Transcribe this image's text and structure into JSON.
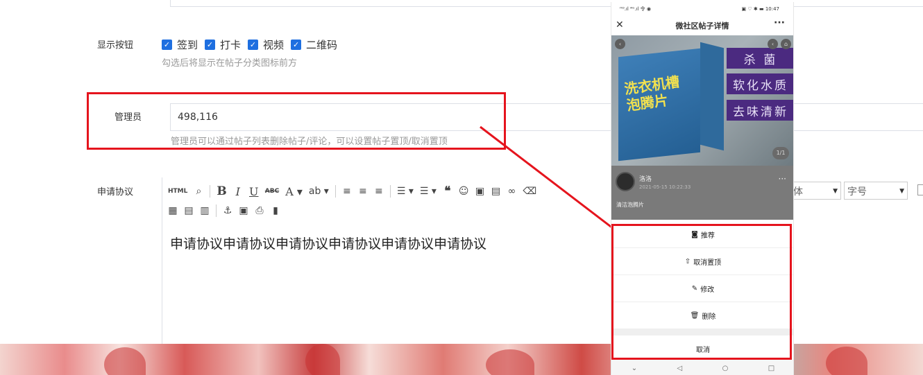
{
  "form": {
    "show_buttons": {
      "label": "显示按钮",
      "options": [
        {
          "label": "签到",
          "checked": true
        },
        {
          "label": "打卡",
          "checked": true
        },
        {
          "label": "视频",
          "checked": true
        },
        {
          "label": "二维码",
          "checked": true
        }
      ],
      "hint": "勾选后将显示在帖子分类图标前方"
    },
    "admin": {
      "label": "管理员",
      "value": "498,116",
      "hint": "管理员可以通过帖子列表删除帖子/评论，可以设置帖子置顶/取消置顶"
    },
    "agreement": {
      "label": "申请协议",
      "content": "申请协议申请协议申请协议申请协议申请协议申请协议",
      "font_family_placeholder": "体",
      "font_size_placeholder": "字号",
      "toolbar_icons": [
        "html-icon",
        "search-replace-icon",
        "bold-icon",
        "italic-icon",
        "underline-icon",
        "strikethrough-icon",
        "font-color-icon",
        "highlight-color-icon",
        "align-left-icon",
        "align-center-icon",
        "align-right-icon",
        "ordered-list-icon",
        "unordered-list-icon",
        "quote-icon",
        "emoji-icon",
        "image-icon",
        "attachment-icon",
        "link-icon",
        "eraser-icon",
        "table-icon",
        "table-row-icon",
        "table-column-icon",
        "anchor-icon",
        "template-icon",
        "print-icon",
        "paste-icon"
      ]
    }
  },
  "phone": {
    "status_left": "ᴴᴰ.ıl ⁴ᴳ.ıl 令 ◉",
    "status_right": "▣ ♡ ✱ ▬ 10:47",
    "nav_title": "微社区帖子详情",
    "product_box_text": "洗衣机槽\n泡腾片",
    "features": [
      "杀 菌",
      "软化水质",
      "去味清新"
    ],
    "pager": "1/1",
    "author_name": "洛洛",
    "post_time": "2021-05-15 10:22:33",
    "post_title": "清洁泡腾片",
    "actions": [
      {
        "icon": "recommend-icon",
        "glyph": "◙",
        "label": "推荐"
      },
      {
        "icon": "unpin-icon",
        "glyph": "⇧",
        "label": "取消置顶"
      },
      {
        "icon": "edit-icon",
        "glyph": "✎",
        "label": "修改"
      },
      {
        "icon": "delete-icon",
        "glyph": "🗑",
        "label": "删除"
      }
    ],
    "cancel_label": "取消"
  },
  "colors": {
    "highlight": "#e5141d",
    "checkbox": "#1e6fe0",
    "feature_bg": "#4b2a80"
  }
}
